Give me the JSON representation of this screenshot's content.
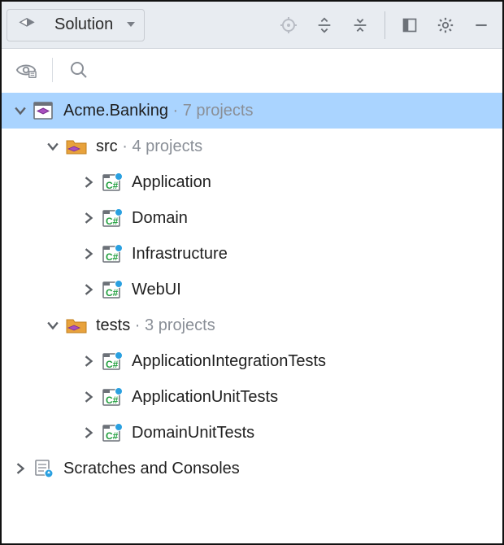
{
  "toolbar": {
    "solution_label": "Solution"
  },
  "tree": {
    "root": {
      "label": "Acme.Banking",
      "meta": "7 projects"
    },
    "src": {
      "label": "src",
      "meta": "4 projects",
      "projects": [
        "Application",
        "Domain",
        "Infrastructure",
        "WebUI"
      ]
    },
    "tests": {
      "label": "tests",
      "meta": "3 projects",
      "projects": [
        "ApplicationIntegrationTests",
        "ApplicationUnitTests",
        "DomainUnitTests"
      ]
    },
    "scratches": {
      "label": "Scratches and Consoles"
    }
  }
}
